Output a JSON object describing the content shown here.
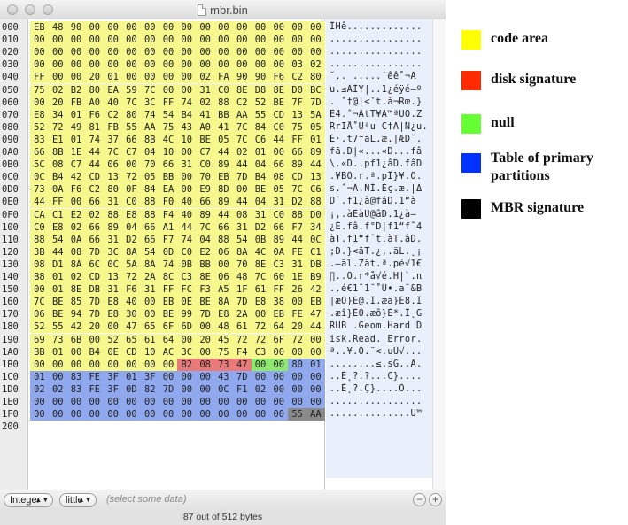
{
  "window": {
    "title": "mbr.bin"
  },
  "hex": {
    "rows": [
      {
        "addr": "000",
        "bytes": [
          "EB",
          "48",
          "90",
          "00",
          "00",
          "00",
          "00",
          "00",
          "00",
          "00",
          "00",
          "00",
          "00",
          "00",
          "00",
          "00"
        ],
        "ascii": "ÎHê............."
      },
      {
        "addr": "010",
        "bytes": [
          "00",
          "00",
          "00",
          "00",
          "00",
          "00",
          "00",
          "00",
          "00",
          "00",
          "00",
          "00",
          "00",
          "00",
          "00",
          "00"
        ],
        "ascii": "................"
      },
      {
        "addr": "020",
        "bytes": [
          "00",
          "00",
          "00",
          "00",
          "00",
          "00",
          "00",
          "00",
          "00",
          "00",
          "00",
          "00",
          "00",
          "00",
          "00",
          "00"
        ],
        "ascii": "................"
      },
      {
        "addr": "030",
        "bytes": [
          "00",
          "00",
          "00",
          "00",
          "00",
          "00",
          "00",
          "00",
          "00",
          "00",
          "00",
          "00",
          "00",
          "00",
          "03",
          "02"
        ],
        "ascii": "................"
      },
      {
        "addr": "040",
        "bytes": [
          "FF",
          "00",
          "00",
          "20",
          "01",
          "00",
          "00",
          "00",
          "00",
          "02",
          "FA",
          "90",
          "90",
          "F6",
          "C2",
          "80"
        ],
        "ascii": "˘.. .....˙êê˚¬Ä"
      },
      {
        "addr": "050",
        "bytes": [
          "75",
          "02",
          "B2",
          "80",
          "EA",
          "59",
          "7C",
          "00",
          "00",
          "31",
          "C0",
          "8E",
          "D8",
          "8E",
          "D0",
          "BC"
        ],
        "ascii": "u.≤ÄÍY|..1¿éÿé–º"
      },
      {
        "addr": "060",
        "bytes": [
          "00",
          "20",
          "FB",
          "A0",
          "40",
          "7C",
          "3C",
          "FF",
          "74",
          "02",
          "88",
          "C2",
          "52",
          "BE",
          "7F",
          "7D"
        ],
        "ascii": ". ˚†@|<ˇt.à¬Rœ.}"
      },
      {
        "addr": "070",
        "bytes": [
          "E8",
          "34",
          "01",
          "F6",
          "C2",
          "80",
          "74",
          "54",
          "B4",
          "41",
          "BB",
          "AA",
          "55",
          "CD",
          "13",
          "5A"
        ],
        "ascii": "Ë4.ˆ¬ÄtT¥A™ªUÕ.Z"
      },
      {
        "addr": "080",
        "bytes": [
          "52",
          "72",
          "49",
          "81",
          "FB",
          "55",
          "AA",
          "75",
          "43",
          "A0",
          "41",
          "7C",
          "84",
          "C0",
          "75",
          "05"
        ],
        "ascii": "RrIÅ˚Uªu C†A|Ñ¿u."
      },
      {
        "addr": "090",
        "bytes": [
          "83",
          "E1",
          "01",
          "74",
          "37",
          "66",
          "8B",
          "4C",
          "10",
          "BE",
          "05",
          "7C",
          "C6",
          "44",
          "FF",
          "01"
        ],
        "ascii": "É·.t7fãL.æ.|ÆD˘."
      },
      {
        "addr": "0A0",
        "bytes": [
          "66",
          "8B",
          "1E",
          "44",
          "7C",
          "C7",
          "04",
          "10",
          "00",
          "C7",
          "44",
          "02",
          "01",
          "00",
          "66",
          "89"
        ],
        "ascii": "fã.D|«...«D...fâ"
      },
      {
        "addr": "0B0",
        "bytes": [
          "5C",
          "08",
          "C7",
          "44",
          "06",
          "00",
          "70",
          "66",
          "31",
          "C0",
          "89",
          "44",
          "04",
          "66",
          "89",
          "44"
        ],
        "ascii": "\\.«D..pf1¿âD.fâD"
      },
      {
        "addr": "0C0",
        "bytes": [
          "0C",
          "B4",
          "42",
          "CD",
          "13",
          "72",
          "05",
          "BB",
          "00",
          "70",
          "EB",
          "7D",
          "B4",
          "08",
          "CD",
          "13"
        ],
        "ascii": ".¥BÕ.r.ª.pÎ}¥.Õ."
      },
      {
        "addr": "0D0",
        "bytes": [
          "73",
          "0A",
          "F6",
          "C2",
          "80",
          "0F",
          "84",
          "EA",
          "00",
          "E9",
          "8D",
          "00",
          "BE",
          "05",
          "7C",
          "C6"
        ],
        "ascii": "s.ˆ¬Ä.ÑÍ.Èç.æ.|Δ"
      },
      {
        "addr": "0E0",
        "bytes": [
          "44",
          "FF",
          "00",
          "66",
          "31",
          "C0",
          "88",
          "F0",
          "40",
          "66",
          "89",
          "44",
          "04",
          "31",
          "D2",
          "88"
        ],
        "ascii": "D˘.f1¿à@fâD.1“à"
      },
      {
        "addr": "0F0",
        "bytes": [
          "CA",
          "C1",
          "E2",
          "02",
          "88",
          "E8",
          "88",
          "F4",
          "40",
          "89",
          "44",
          "08",
          "31",
          "C0",
          "88",
          "D0"
        ],
        "ascii": "¡,.àÈàÙ@âD.1¿à–"
      },
      {
        "addr": "100",
        "bytes": [
          "C0",
          "E8",
          "02",
          "66",
          "89",
          "04",
          "66",
          "A1",
          "44",
          "7C",
          "66",
          "31",
          "D2",
          "66",
          "F7",
          "34"
        ],
        "ascii": "¿È.fâ.f°D|f1“f˜4"
      },
      {
        "addr": "110",
        "bytes": [
          "88",
          "54",
          "0A",
          "66",
          "31",
          "D2",
          "66",
          "F7",
          "74",
          "04",
          "88",
          "54",
          "0B",
          "89",
          "44",
          "0C"
        ],
        "ascii": "àT.f1“f˜t.àT.âD."
      },
      {
        "addr": "120",
        "bytes": [
          "3B",
          "44",
          "08",
          "7D",
          "3C",
          "8A",
          "54",
          "0D",
          "C0",
          "E2",
          "06",
          "8A",
          "4C",
          "0A",
          "FE",
          "C1"
        ],
        "ascii": ";D.}<äT.¿,.äL.˛¡"
      },
      {
        "addr": "130",
        "bytes": [
          "08",
          "D1",
          "8A",
          "6C",
          "0C",
          "5A",
          "8A",
          "74",
          "0B",
          "BB",
          "00",
          "70",
          "8E",
          "C3",
          "31",
          "DB"
        ],
        "ascii": ".–äl.Zät.ª.pé√1€"
      },
      {
        "addr": "140",
        "bytes": [
          "B8",
          "01",
          "02",
          "CD",
          "13",
          "72",
          "2A",
          "8C",
          "C3",
          "8E",
          "06",
          "48",
          "7C",
          "60",
          "1E",
          "B9"
        ],
        "ascii": "∏..Õ.r*å√é.H|`.π"
      },
      {
        "addr": "150",
        "bytes": [
          "00",
          "01",
          "8E",
          "DB",
          "31",
          "F6",
          "31",
          "FF",
          "FC",
          "F3",
          "A5",
          "1F",
          "61",
          "FF",
          "26",
          "42"
        ],
        "ascii": "..é€1˘1˘˚Û•.a˘&B"
      },
      {
        "addr": "160",
        "bytes": [
          "7C",
          "BE",
          "85",
          "7D",
          "E8",
          "40",
          "00",
          "EB",
          "0E",
          "BE",
          "8A",
          "7D",
          "E8",
          "38",
          "00",
          "EB"
        ],
        "ascii": "|æÖ}È@.Î.æä}È8.Î"
      },
      {
        "addr": "170",
        "bytes": [
          "06",
          "BE",
          "94",
          "7D",
          "E8",
          "30",
          "00",
          "BE",
          "99",
          "7D",
          "E8",
          "2A",
          "00",
          "EB",
          "FE",
          "47"
        ],
        "ascii": ".æî}È0.æô}È*.Î˛G"
      },
      {
        "addr": "180",
        "bytes": [
          "52",
          "55",
          "42",
          "20",
          "00",
          "47",
          "65",
          "6F",
          "6D",
          "00",
          "48",
          "61",
          "72",
          "64",
          "20",
          "44"
        ],
        "ascii": "RUB .Geom.Hard D"
      },
      {
        "addr": "190",
        "bytes": [
          "69",
          "73",
          "6B",
          "00",
          "52",
          "65",
          "61",
          "64",
          "00",
          "20",
          "45",
          "72",
          "72",
          "6F",
          "72",
          "00"
        ],
        "ascii": "isk.Read. Error."
      },
      {
        "addr": "1A0",
        "bytes": [
          "BB",
          "01",
          "00",
          "B4",
          "0E",
          "CD",
          "10",
          "AC",
          "3C",
          "00",
          "75",
          "F4",
          "C3",
          "00",
          "00",
          "00"
        ],
        "ascii": "ª..¥.Õ.¨<.uÙ√..."
      },
      {
        "addr": "1B0",
        "bytes": [
          "00",
          "00",
          "00",
          "00",
          "00",
          "00",
          "00",
          "00",
          "B2",
          "08",
          "73",
          "47",
          "00",
          "00",
          "80",
          "01"
        ],
        "ascii": "........≤.sG..Ä."
      },
      {
        "addr": "1C0",
        "bytes": [
          "01",
          "00",
          "83",
          "FE",
          "3F",
          "01",
          "3F",
          "00",
          "00",
          "00",
          "43",
          "7D",
          "00",
          "00",
          "00",
          "00"
        ],
        "ascii": "..É˛?.?...C}...."
      },
      {
        "addr": "1D0",
        "bytes": [
          "02",
          "02",
          "83",
          "FE",
          "3F",
          "0D",
          "82",
          "7D",
          "00",
          "00",
          "0C",
          "F1",
          "02",
          "00",
          "00",
          "00"
        ],
        "ascii": "..É˛?.Ç}....Ò..."
      },
      {
        "addr": "1E0",
        "bytes": [
          "00",
          "00",
          "00",
          "00",
          "00",
          "00",
          "00",
          "00",
          "00",
          "00",
          "00",
          "00",
          "00",
          "00",
          "00",
          "00"
        ],
        "ascii": "................"
      },
      {
        "addr": "1F0",
        "bytes": [
          "00",
          "00",
          "00",
          "00",
          "00",
          "00",
          "00",
          "00",
          "00",
          "00",
          "00",
          "00",
          "00",
          "00",
          "55",
          "AA"
        ],
        "ascii": "..............U™"
      },
      {
        "addr": "200",
        "bytes": [],
        "ascii": ""
      }
    ]
  },
  "bottombar": {
    "format_select": "Integer",
    "endian_select": "little",
    "hint": "(select some data)"
  },
  "status": {
    "text": "87 out of 512 bytes"
  },
  "colors": {
    "code": "#f6f78c",
    "signature": "#e87a7a",
    "null": "#8ee870",
    "partition": "#8fa8ee",
    "mbr_sig": "#8a8a8a"
  },
  "legend": {
    "items": [
      {
        "label": "code area",
        "color": "#ffff00"
      },
      {
        "label": "disk signature",
        "color": "#ff2a00"
      },
      {
        "label": "null",
        "color": "#66ff33"
      },
      {
        "label": "Table of primary partitions",
        "color": "#0033ff"
      },
      {
        "label": "MBR signature",
        "color": "#000000"
      }
    ]
  }
}
